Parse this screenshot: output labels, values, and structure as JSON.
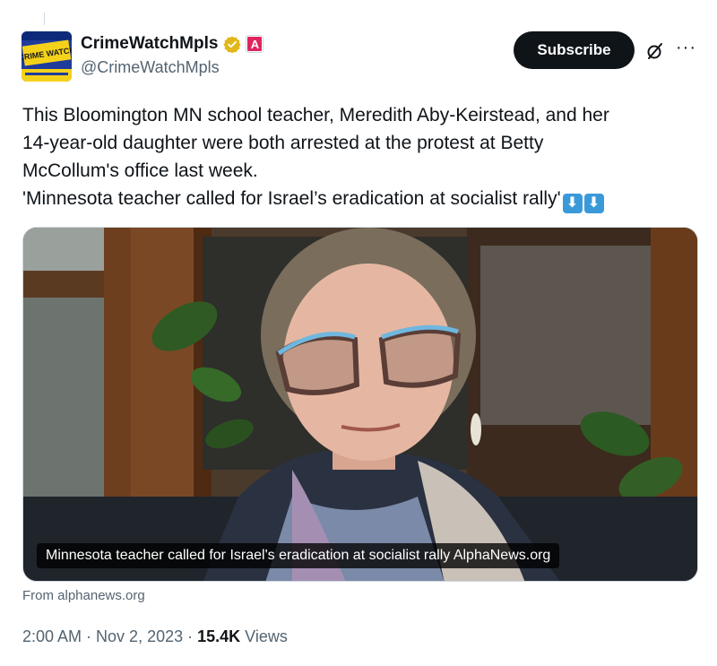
{
  "author": {
    "display_name": "CrimeWatchMpls",
    "handle": "@CrimeWatchMpls",
    "verified_color": "#e2b719",
    "affiliate_label": "A",
    "avatar_text": "CRIME WATCH"
  },
  "actions": {
    "subscribe_label": "Subscribe",
    "grok_icon": "grok-icon",
    "more_icon": "more-icon"
  },
  "tweet": {
    "lines": [
      "This Bloomington MN school teacher, Meredith Aby-Keirstead, and her",
      "14-year-old daughter were both arrested at the protest at Betty",
      "McCollum's office last week.",
      "'Minnesota teacher called for Israel’s eradication at socialist rally'"
    ],
    "emoji": [
      "⬇",
      "⬇"
    ]
  },
  "media": {
    "caption": "Minnesota teacher called for Israel's eradication at socialist rally AlphaNews.org",
    "source": "From alphanews.org"
  },
  "meta": {
    "time": "2:00 AM",
    "sep1": " · ",
    "date": "Nov 2, 2023",
    "sep2": " · ",
    "views_count": "15.4K",
    "views_label": " Views"
  }
}
